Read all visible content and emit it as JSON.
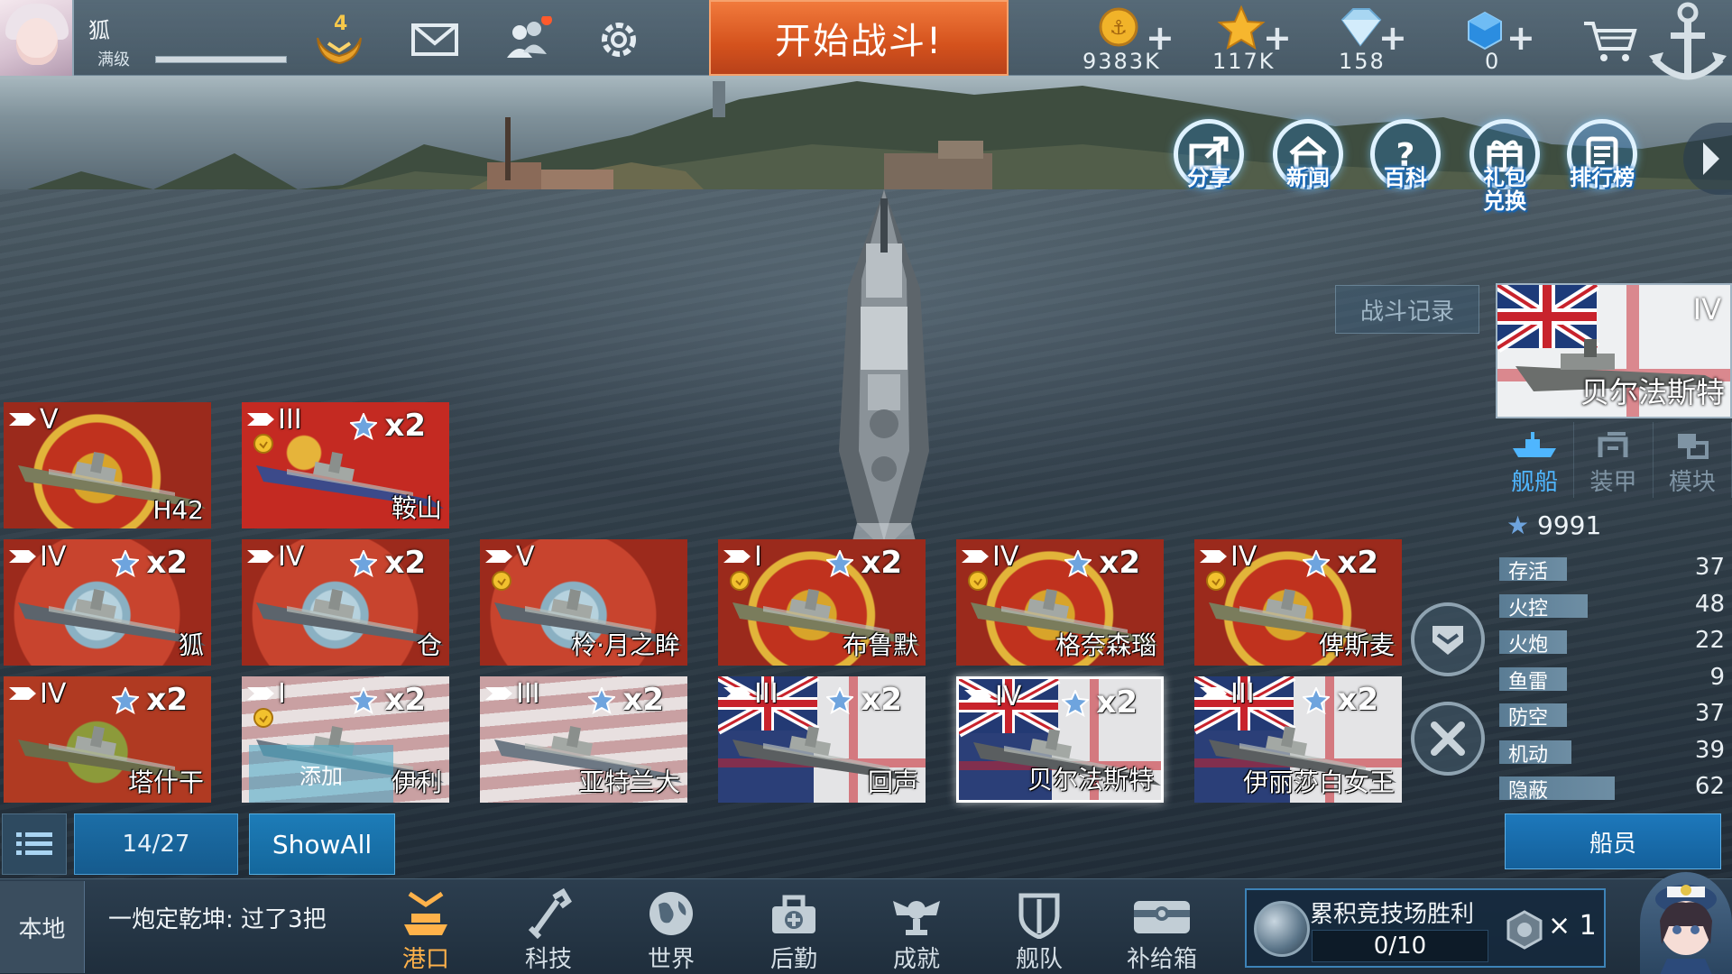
{
  "player": {
    "name": "狐",
    "level_label": "满级",
    "xp_fraction": 1.0,
    "rank": "4"
  },
  "top_icons": [
    "rank-badge-icon",
    "mail-icon",
    "friends-icon",
    "settings-icon"
  ],
  "battle_button": "开始战斗!",
  "currencies": [
    {
      "icon": "gold-coin-icon",
      "value": "9383K",
      "plus": "+"
    },
    {
      "icon": "star-icon",
      "value": "117K",
      "plus": "+"
    },
    {
      "icon": "diamond-icon",
      "value": "158",
      "plus": "+"
    },
    {
      "icon": "blue-gem-icon",
      "value": "0",
      "plus": "+"
    }
  ],
  "features": [
    {
      "label": "分享",
      "icon": "share-icon"
    },
    {
      "label": "新闻",
      "icon": "news-icon"
    },
    {
      "label": "百科",
      "icon": "encyclopedia-icon"
    },
    {
      "label": "礼包\n兑换",
      "label_l1": "礼包",
      "label_l2": "兑换",
      "icon": "gift-exchange-icon"
    },
    {
      "label": "排行榜",
      "icon": "leaderboard-icon"
    }
  ],
  "battle_record": "战斗记录",
  "selected_ship": {
    "tier": "IV",
    "name": "贝尔法斯特",
    "tabs": [
      "舰船",
      "装甲",
      "模块"
    ],
    "stars": "9991",
    "stats": [
      {
        "name": "存活",
        "value": "37",
        "fraction": 0.3
      },
      {
        "name": "火控",
        "value": "48",
        "fraction": 0.39
      },
      {
        "name": "火炮",
        "value": "22",
        "fraction": 0.3
      },
      {
        "name": "鱼雷",
        "value": "9",
        "fraction": 0.3
      },
      {
        "name": "防空",
        "value": "37",
        "fraction": 0.3
      },
      {
        "name": "机动",
        "value": "39",
        "fraction": 0.32
      },
      {
        "name": "隐蔽",
        "value": "62",
        "fraction": 0.51
      }
    ],
    "crew_button": "船员"
  },
  "ships": [
    {
      "tier": "V",
      "name": "H42",
      "mult": "",
      "theme": "de",
      "medal": false
    },
    {
      "tier": "III",
      "name": "鞍山",
      "mult": "x2",
      "theme": "cn",
      "medal": true
    },
    {
      "tier": "IV",
      "name": "狐",
      "mult": "x2",
      "theme": "jp",
      "medal": false
    },
    {
      "tier": "IV",
      "name": "仓",
      "mult": "x2",
      "theme": "jp",
      "medal": false
    },
    {
      "tier": "V",
      "name": "柃·月之眸",
      "mult": "",
      "theme": "jp",
      "medal": true
    },
    {
      "tier": "I",
      "name": "布鲁默",
      "mult": "x2",
      "theme": "de",
      "medal": true
    },
    {
      "tier": "IV",
      "name": "格奈森瑙",
      "mult": "x2",
      "theme": "de",
      "medal": true
    },
    {
      "tier": "IV",
      "name": "俾斯麦",
      "mult": "x2",
      "theme": "de",
      "medal": true
    },
    {
      "tier": "IV",
      "name": "塔什干",
      "mult": "x2",
      "theme": "ru",
      "medal": false
    },
    {
      "tier": "I",
      "name": "伊利",
      "mult": "x2",
      "theme": "us",
      "medal": true,
      "overlay": "添加"
    },
    {
      "tier": "III",
      "name": "亚特兰大",
      "mult": "x2",
      "theme": "us",
      "medal": false
    },
    {
      "tier": "III",
      "name": "回声",
      "mult": "x2",
      "theme": "uk",
      "medal": false
    },
    {
      "tier": "IV",
      "name": "贝尔法斯特",
      "mult": "x2",
      "theme": "uk",
      "medal": false,
      "selected": true
    },
    {
      "tier": "III",
      "name": "伊丽莎白女王",
      "mult": "x2",
      "theme": "uk",
      "medal": false
    }
  ],
  "fleet_count": "14/27",
  "show_all": "ShowAll",
  "chat": {
    "channel": "本地",
    "message": "一炮定乾坤: 过了3把"
  },
  "nav": [
    {
      "label": "港口",
      "icon": "harbor-icon",
      "active": true
    },
    {
      "label": "科技",
      "icon": "tech-icon"
    },
    {
      "label": "世界",
      "icon": "world-icon"
    },
    {
      "label": "后勤",
      "icon": "logistics-icon"
    },
    {
      "label": "成就",
      "icon": "achievement-icon"
    },
    {
      "label": "舰队",
      "icon": "fleet-icon"
    },
    {
      "label": "补给箱",
      "icon": "supply-box-icon"
    }
  ],
  "arena": {
    "title": "累积竞技场胜利",
    "progress": "0/10",
    "reward_count": "× 1"
  },
  "colors": {
    "accent": "#e2642c",
    "blue": "#1c6ea7",
    "active_nav": "#ffb24a"
  }
}
